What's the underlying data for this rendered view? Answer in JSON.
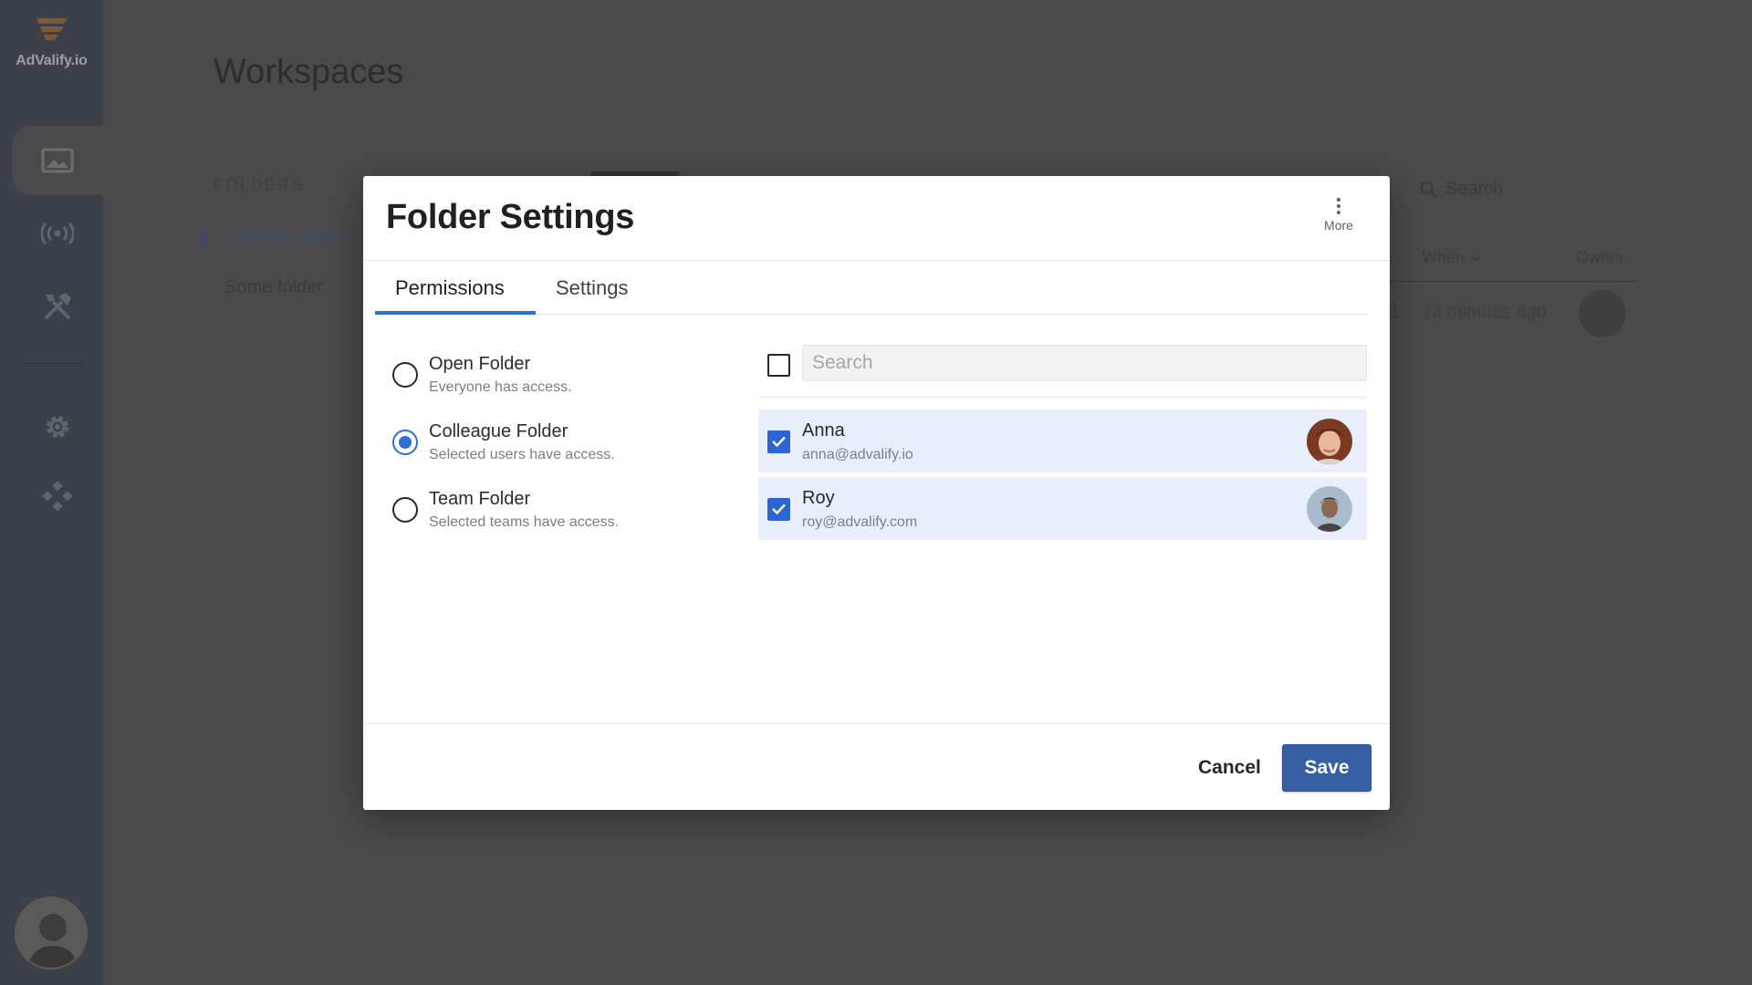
{
  "app": {
    "brand": "AdValify.io"
  },
  "sidebar": {
    "items": [
      {
        "icon": "image-icon",
        "active": true
      },
      {
        "icon": "broadcast-icon",
        "active": false
      },
      {
        "icon": "tools-icon",
        "active": false
      },
      {
        "icon": "gear-icon",
        "active": false
      },
      {
        "icon": "integrations-icon",
        "active": false
      }
    ]
  },
  "background": {
    "title": "Workspaces",
    "folders_label": "FOLDERS",
    "folders": [
      "Another folder",
      "Some folder"
    ],
    "search_placeholder": "Search",
    "columns": {
      "when": "When",
      "owner": "Owner"
    },
    "row": {
      "count": "1",
      "when": "23 minutes ago"
    }
  },
  "modal": {
    "title": "Folder Settings",
    "more_label": "More",
    "tabs": [
      {
        "label": "Permissions",
        "active": true
      },
      {
        "label": "Settings",
        "active": false
      }
    ],
    "options": [
      {
        "label": "Open Folder",
        "description": "Everyone has access.",
        "selected": false
      },
      {
        "label": "Colleague Folder",
        "description": "Selected users have access.",
        "selected": true
      },
      {
        "label": "Team Folder",
        "description": "Selected teams have access.",
        "selected": false
      }
    ],
    "search_placeholder": "Search",
    "users": [
      {
        "name": "Anna",
        "email": "anna@advalify.io",
        "checked": true
      },
      {
        "name": "Roy",
        "email": "roy@advalify.com",
        "checked": true
      }
    ],
    "cancel_label": "Cancel",
    "save_label": "Save"
  },
  "colors": {
    "accent": "#2e6fd5",
    "save_button": "#355ea3",
    "selected_row": "#e8eefb",
    "overlay": "#4a4a4c"
  }
}
